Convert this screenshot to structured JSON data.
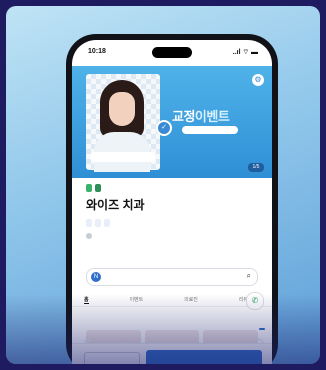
{
  "status_bar": {
    "time": "10:18",
    "icons": "..ıl ⌔ ▬"
  },
  "banner": {
    "headline_main": "교정",
    "headline_accent": "이벤트",
    "counter": "1/5"
  },
  "clinic": {
    "name": "와이즈 치과"
  },
  "tabs": [
    {
      "label": "홈",
      "active": true
    },
    {
      "label": "이벤트",
      "active": false
    },
    {
      "label": "의료진",
      "active": false
    },
    {
      "label": "리뷰",
      "active": false
    }
  ],
  "icons": {
    "settings": "gear-icon",
    "verified": "check-icon",
    "phone": "phone-icon",
    "chat": "chat-icon",
    "search": "search-icon"
  },
  "colors": {
    "primary": "#2f6ec9",
    "banner": "#3a9ee0",
    "badge_green": "#3bb26b",
    "background": "#1e1b60"
  }
}
